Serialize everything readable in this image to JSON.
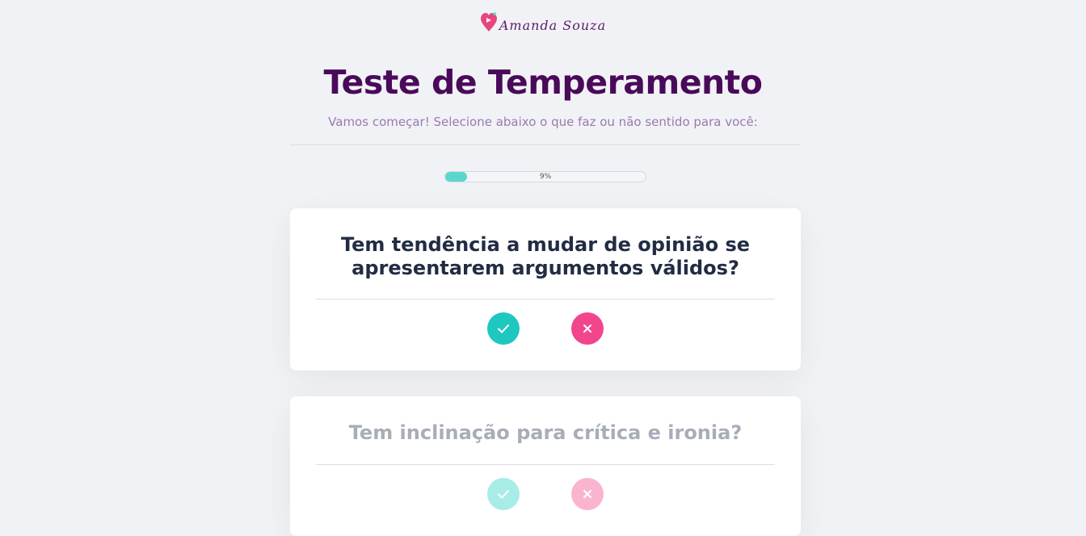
{
  "brand": {
    "name": "Amanda Souza",
    "logo_icon": "heart-pin-icon",
    "primary_color": "#4a0a5a"
  },
  "header": {
    "title": "Teste de Temperamento",
    "subtitle": "Vamos começar! Selecione abaixo o que faz ou não sentido para você:"
  },
  "progress": {
    "value_percent": 9,
    "label": "9%",
    "fill_color": "#5ad6cf"
  },
  "questions": [
    {
      "text": "Tem tendência a mudar de opinião se apresentarem argumentos válidos?",
      "state": "active",
      "yes_icon": "check-icon",
      "no_icon": "close-icon"
    },
    {
      "text": "Tem inclinação para crítica e ironia?",
      "state": "inactive",
      "yes_icon": "check-icon",
      "no_icon": "close-icon"
    }
  ],
  "colors": {
    "yes": "#1ec8c0",
    "no": "#f2468c"
  }
}
